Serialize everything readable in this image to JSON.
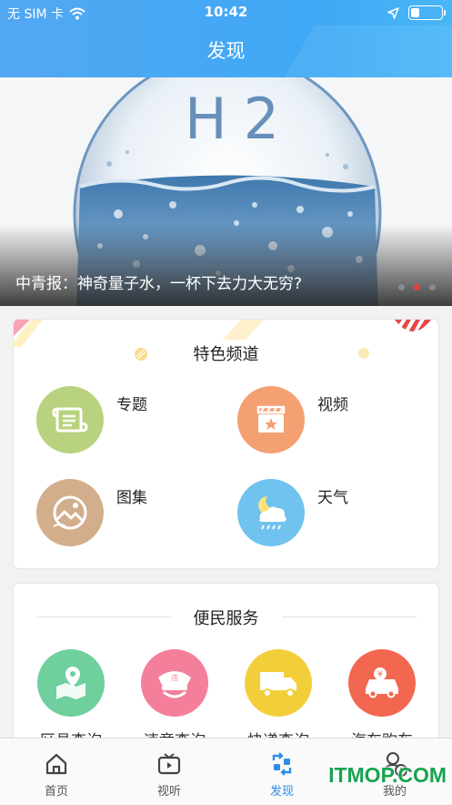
{
  "status_bar": {
    "carrier": "无 SIM 卡",
    "time": "10:42"
  },
  "header": {
    "title": "发现"
  },
  "banner": {
    "caption": "中青报：神奇量子水，一杯下去力大无穷?",
    "art_text": "H2",
    "slides_count": 3,
    "active_slide": 2
  },
  "channels": {
    "title": "特色频道",
    "items": [
      {
        "label": "专题",
        "icon": "scroll-icon",
        "color": "#b9d27f"
      },
      {
        "label": "视频",
        "icon": "video-clapper-icon",
        "color": "#f4a072"
      },
      {
        "label": "图集",
        "icon": "picture-icon",
        "color": "#d3ae8c"
      },
      {
        "label": "天气",
        "icon": "weather-icon",
        "color": "#6fc3ee"
      }
    ]
  },
  "services": {
    "title": "便民服务",
    "items": [
      {
        "label": "区县查询",
        "icon": "map-location-icon",
        "color": "#6fcf9d"
      },
      {
        "label": "违章查询",
        "icon": "police-cap-icon",
        "color": "#f47f9b"
      },
      {
        "label": "快递查询",
        "icon": "truck-icon",
        "color": "#f2cf3a"
      },
      {
        "label": "汽车购车",
        "icon": "car-price-icon",
        "color": "#f2674f"
      }
    ]
  },
  "tabbar": {
    "items": [
      {
        "label": "首页",
        "icon": "home-icon"
      },
      {
        "label": "视听",
        "icon": "tv-icon"
      },
      {
        "label": "发现",
        "icon": "discover-icon",
        "active": true
      },
      {
        "label": "我的",
        "icon": "profile-icon"
      }
    ]
  },
  "watermark": "ITMOP.COM",
  "colors": {
    "primary": "#3fa9f5",
    "active_tab": "#2b8de8",
    "dot_active": "#e6403d"
  }
}
